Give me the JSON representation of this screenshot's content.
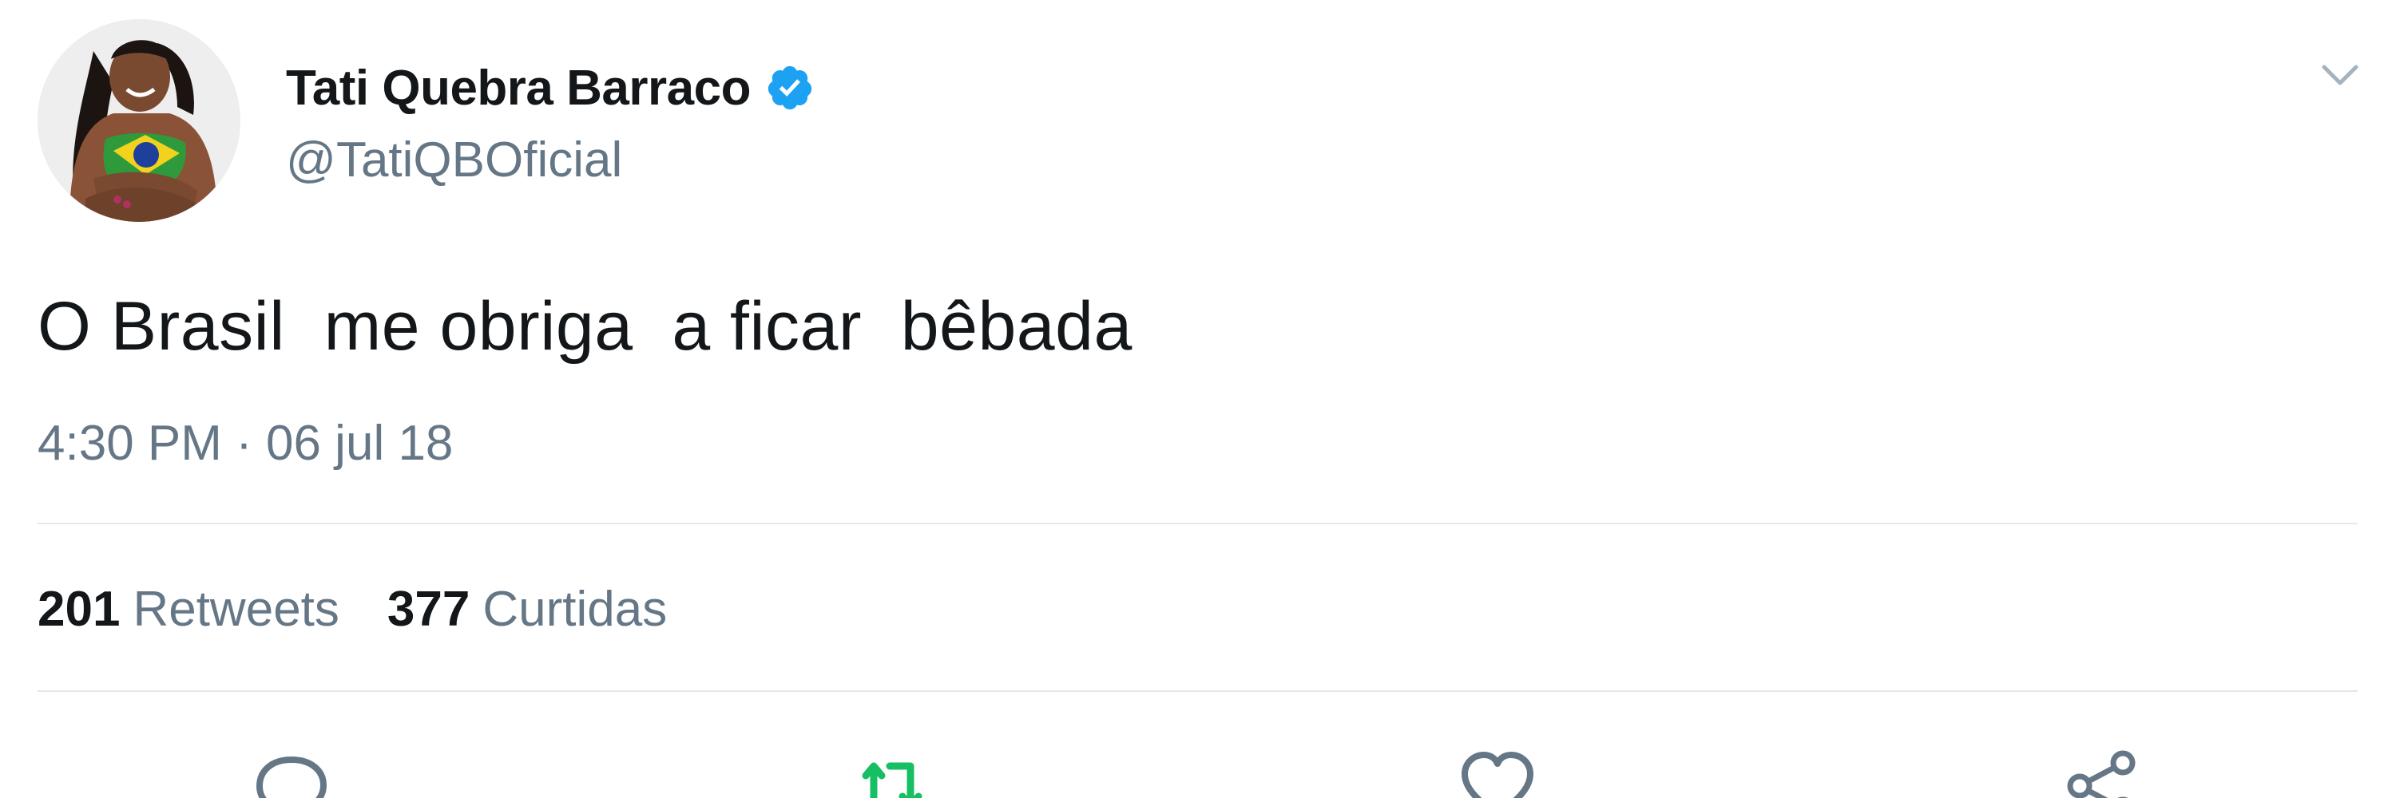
{
  "user": {
    "display_name": "Tati Quebra Barraco",
    "handle": "@TatiQBOficial",
    "verified": true
  },
  "tweet": {
    "text": "O Brasil  me obriga  a ficar  bêbada",
    "timestamp": "4:30 PM · 06 jul 18"
  },
  "stats": {
    "retweets_count": "201",
    "retweets_label": "Retweets",
    "likes_count": "377",
    "likes_label": "Curtidas"
  },
  "actions": {
    "reply_icon": "reply-icon",
    "retweet_icon": "retweet-icon",
    "like_icon": "heart-icon",
    "share_icon": "share-icon"
  },
  "colors": {
    "verified_blue": "#1da1f2",
    "retweet_green": "#17bf63",
    "secondary_text": "#657786",
    "icon_gray": "#657786",
    "divider": "#e1e8ed"
  }
}
